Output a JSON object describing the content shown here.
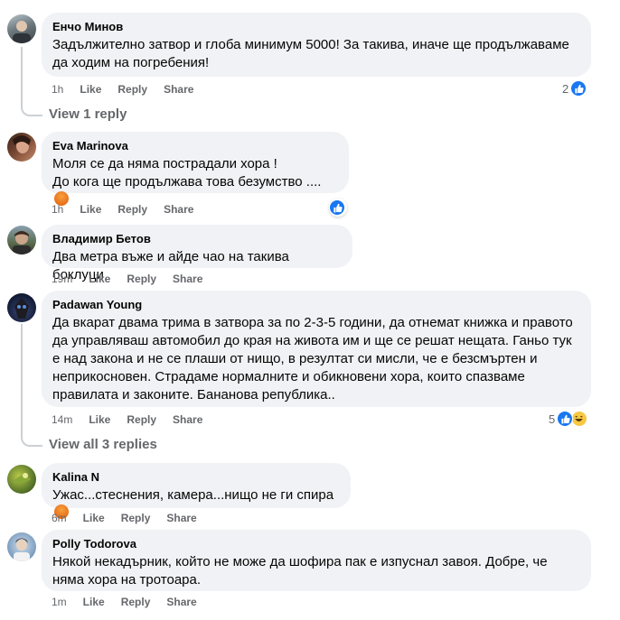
{
  "comments": [
    {
      "author": "Енчо Минов",
      "text": "Задължително затвор и глоба минимум 5000! За такива, иначе ще продължаваме да ходим на погребения!",
      "time": "1h",
      "like": "Like",
      "reply": "Reply",
      "share": "Share",
      "reaction_count": "2"
    },
    {
      "author": "Eva Marinova",
      "text_line1": "Моля се да няма пострадали хора !",
      "text_line2": "До кога ще продължава това безумство ....",
      "time": "1h",
      "like": "Like",
      "reply": "Reply",
      "share": "Share"
    },
    {
      "author": "Владимир Бетов",
      "text": "Два метра въже и айде чао на такива боклуци",
      "time": "19m",
      "like": "Like",
      "reply": "Reply",
      "share": "Share"
    },
    {
      "author": "Padawan Young",
      "text": "Да вкарат двама трима в затвора за по 2-3-5 години, да отнемат книжка и правото да управляваш автомобил до края на живота им и ще се решат нещата. Ганьо тук е над закона и не се плаши от нищо, в резултат си мисли, че е безсмъртен и неприкосновен. Страдаме нормалните и обикновени хора, които спазваме правилата и законите. Бананова република..",
      "time": "14m",
      "like": "Like",
      "reply": "Reply",
      "share": "Share",
      "reaction_count": "5"
    },
    {
      "author": "Kalina N",
      "text": "Ужас...стеснения, камера...нищо не ги спира",
      "time": "6m",
      "like": "Like",
      "reply": "Reply",
      "share": "Share"
    },
    {
      "author": "Polly Todorova",
      "text": "Някой некадърник, който не може да шофира пак е изпуснал завоя. Добре, че няма хора на тротоара.",
      "time": "1m",
      "like": "Like",
      "reply": "Reply",
      "share": "Share"
    }
  ],
  "view_replies_1": "View 1 reply",
  "view_replies_2": "View all 3 replies",
  "colors": {
    "bubble": "#f0f2f5",
    "like_blue": "#1877f2",
    "meta_gray": "#65676b",
    "angry": "#e9710f",
    "haha": "#f7c844"
  }
}
